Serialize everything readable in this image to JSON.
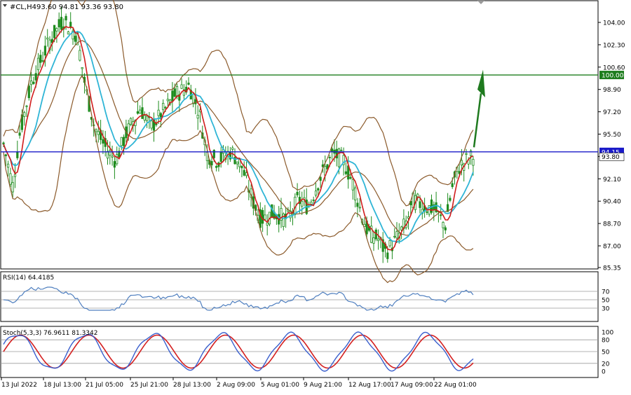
{
  "header": {
    "symbol": "#CL,H4",
    "ohlc": "93.60 94.81 93.36 93.80"
  },
  "main_chart": {
    "price_ticks": [
      "104.00",
      "102.30",
      "100.60",
      "98.90",
      "97.20",
      "95.50",
      "93.80",
      "92.10",
      "90.40",
      "88.70",
      "87.00",
      "85.35"
    ],
    "lines": [
      {
        "name": "resistance",
        "price": 100.0,
        "label": "100.00",
        "color": "#1e7d1e"
      },
      {
        "name": "current-level",
        "price": 94.15,
        "label": "94.15",
        "color": "#1a1ac8"
      }
    ],
    "current_price_label": "93.80",
    "forecast_arrow_color": "#1f7a1f"
  },
  "rsi_panel": {
    "label": "RSI(14) 64.4185",
    "ticks": [
      "70",
      "50",
      "30"
    ],
    "color": "#4f7fbf"
  },
  "stoch_panel": {
    "label": "Stoch(5,3,3) 76.9611 81.3342",
    "ticks": [
      "100",
      "80",
      "50",
      "20",
      "0"
    ],
    "main_color": "#3a5fcd",
    "signal_color": "#d42020"
  },
  "time_axis": {
    "labels": [
      "13 Jul 2022",
      "18 Jul 13:00",
      "21 Jul 05:00",
      "25 Jul 21:00",
      "28 Jul 13:00",
      "2 Aug 09:00",
      "5 Aug 01:00",
      "9 Aug 21:00",
      "12 Aug 17:00",
      "17 Aug 09:00",
      "22 Aug 01:00"
    ]
  },
  "indicator_colors": {
    "bollinger": "#8b5a2b",
    "fast_ma": "#d01c1c",
    "slow_ma": "#2fb5d6",
    "candles": "#1e8c1e"
  }
}
